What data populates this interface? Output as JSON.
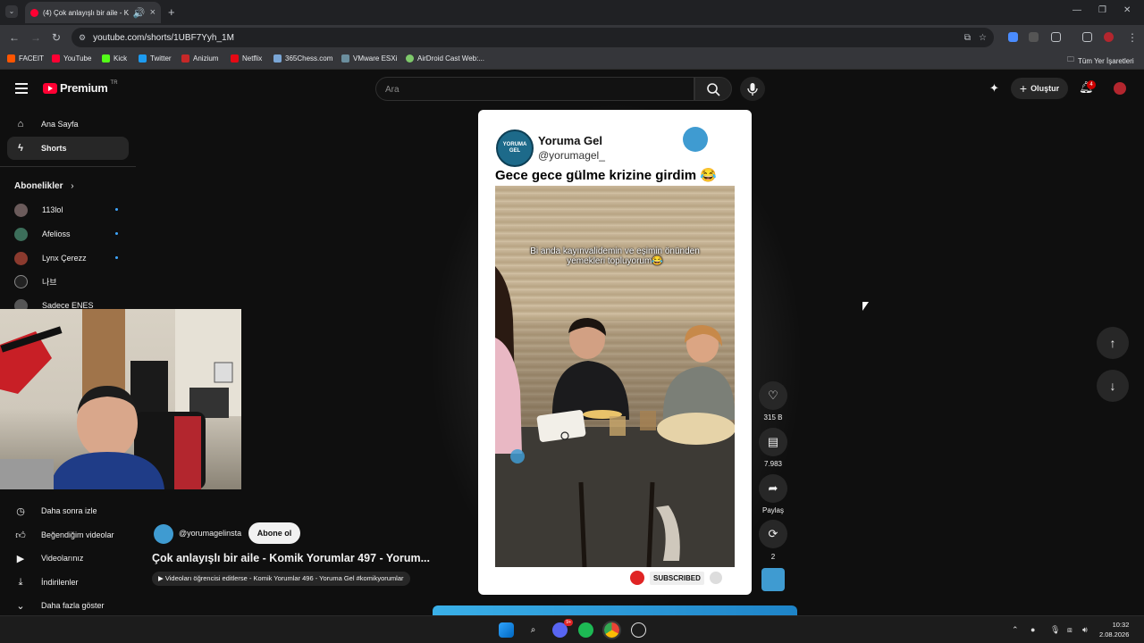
{
  "browser": {
    "tab_title": "(4) Çok anlayışlı bir aile - Ko",
    "url": "youtube.com/shorts/1UBF7Yyh_1M",
    "bookmarks": [
      "FACEIT",
      "YouTube",
      "Kick",
      "Twitter",
      "Anizium",
      "Netflix",
      "365Chess.com",
      "VMware ESXi",
      "AirDroid Cast Web:..."
    ],
    "all_bookmarks": "Tüm Yer İşaretleri"
  },
  "youtube": {
    "logo": "Premium",
    "logo_region": "TR",
    "search_placeholder": "Ara",
    "create_label": "Oluştur",
    "notifications": "4"
  },
  "sidebar": {
    "items": [
      {
        "label": "Ana Sayfa",
        "icon": "home-icon"
      },
      {
        "label": "Shorts",
        "icon": "shorts-icon"
      }
    ],
    "subscriptions_header": "Abonelikler",
    "subscriptions": [
      "113lol",
      "Afelioss",
      "Lynx Çerezz",
      "나브",
      "Sadece ENES"
    ],
    "bottom_items": [
      {
        "label": "Daha sonra izle",
        "icon": "clock-icon"
      },
      {
        "label": "Beğendiğim videolar",
        "icon": "thumbs-up-icon"
      },
      {
        "label": "Videolarınız",
        "icon": "play-square-icon"
      },
      {
        "label": "İndirilenler",
        "icon": "download-icon"
      },
      {
        "label": "Daha fazla göster",
        "icon": "chevron-down-icon"
      }
    ]
  },
  "short": {
    "channel_name": "Yoruma Gel",
    "channel_handle": "@yorumagel_",
    "avatar_text": "YORUMA GEL",
    "caption": "Gece gece gülme krizine girdim 😂",
    "video_overlay_text": "Bi anda kayınvalidemin ve eşimin önünden yemekleri topluyorum😂",
    "subscribed_label": "SUBSCRIBED",
    "likes": "315 B",
    "comments": "7.983",
    "share_label": "Paylaş",
    "remix_count": "2"
  },
  "meta": {
    "handle": "@yorumagelinsta",
    "subscribe_label": "Abone ol",
    "title": "Çok anlayışlı bir aile - Komik Yorumlar 497 - Yorum...",
    "playlist": "Videoları öğrencisi editlerse - Komik Yorumlar 496 - Yoruma Gel #komikyorumlar"
  },
  "taskbar": {
    "time": "10:32",
    "date": "2.08.2026",
    "discord_badge": "9+"
  }
}
